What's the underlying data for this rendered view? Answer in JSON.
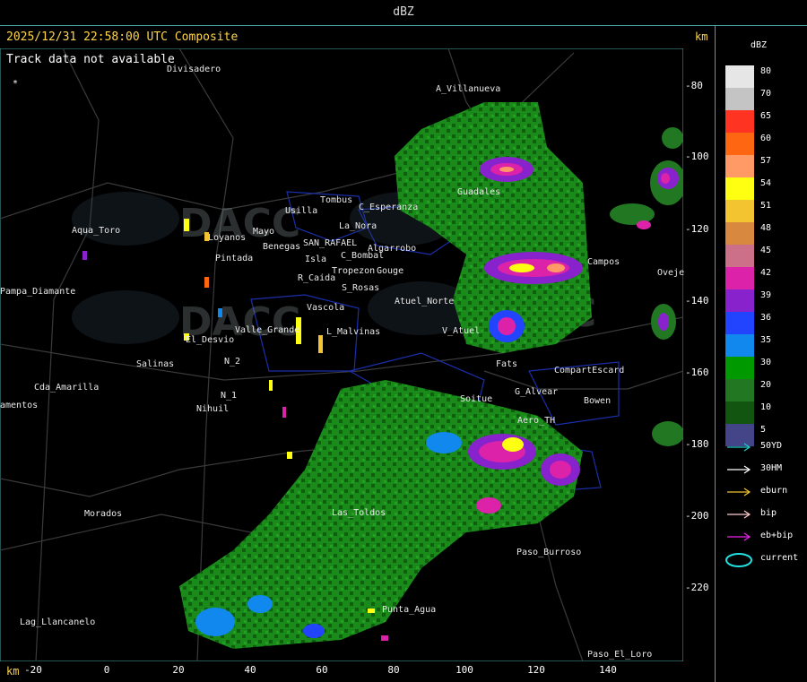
{
  "header": {
    "title": "dBZ"
  },
  "map_header": {
    "timestamp": "2025/12/31 22:58:00 UTC Composite",
    "km_label": "km",
    "track_message": "Track data not available"
  },
  "axes": {
    "y_ticks": [
      "-80",
      "-100",
      "-120",
      "-140",
      "-160",
      "-180",
      "-200",
      "-220"
    ],
    "x_ticks": [
      "-20",
      "0",
      "20",
      "40",
      "60",
      "80",
      "100",
      "120",
      "140"
    ],
    "x_unit": "km"
  },
  "legend": {
    "title": "dBZ",
    "levels": [
      {
        "value": "80",
        "color": "#e6e6e6"
      },
      {
        "value": "70",
        "color": "#c4c4c4"
      },
      {
        "value": "65",
        "color": "#ff3322"
      },
      {
        "value": "60",
        "color": "#ff6611"
      },
      {
        "value": "57",
        "color": "#ff9966"
      },
      {
        "value": "54",
        "color": "#ffff11"
      },
      {
        "value": "51",
        "color": "#f4c430"
      },
      {
        "value": "48",
        "color": "#d98840"
      },
      {
        "value": "45",
        "color": "#cc6f88"
      },
      {
        "value": "42",
        "color": "#dd22aa"
      },
      {
        "value": "39",
        "color": "#8822cc"
      },
      {
        "value": "36",
        "color": "#2244ff"
      },
      {
        "value": "35",
        "color": "#1188ee"
      },
      {
        "value": "30",
        "color": "#009900"
      },
      {
        "value": "20",
        "color": "#227722"
      },
      {
        "value": "10",
        "color": "#115511"
      },
      {
        "value": "5",
        "color": "#444488"
      }
    ],
    "tracks": [
      {
        "label": "50YD",
        "color": "#22cccc"
      },
      {
        "label": "30HM",
        "color": "#ffffff"
      },
      {
        "label": "eburn",
        "color": "#f4c430"
      },
      {
        "label": "bip",
        "color": "#ffcccc"
      },
      {
        "label": "eb+bip",
        "color": "#ee22ee"
      },
      {
        "label": "current",
        "color": "#22e0e0"
      }
    ]
  },
  "places": [
    "Divisadero",
    "A_Villanueva",
    "Guadales",
    "Tombus",
    "Usilla",
    "C_Esperanza",
    "La_Nora",
    "Aqua_Toro",
    "SAN_RAFAEL",
    "Loyanos",
    "Mayo",
    "Benegas",
    "Algarrobo",
    "C_Bombal",
    "Isla",
    "Pintada",
    "R_Caida",
    "Tropezon",
    "Gouge",
    "S_Rosas",
    "Atuel_Norte",
    "Pampa_Diamante",
    "Vascola",
    "El_Desvio",
    "Valle_Grande",
    "L_Malvinas",
    "V_Atuel",
    "Salinas",
    "N_2",
    "N_1",
    "Nihuil",
    "Cda_Amarilla",
    "amentos",
    "Morados",
    "Las_Toldos",
    "Punta_Agua",
    "Paso_Burroso",
    "Lag_Llancanelo",
    "Paso_El_Loro",
    "Oveje",
    "CompartEscard",
    "Bowen",
    "Soitue",
    "G_Alvear",
    "Aero_TH",
    "Campos",
    "Fats"
  ],
  "watermark": "DACC"
}
